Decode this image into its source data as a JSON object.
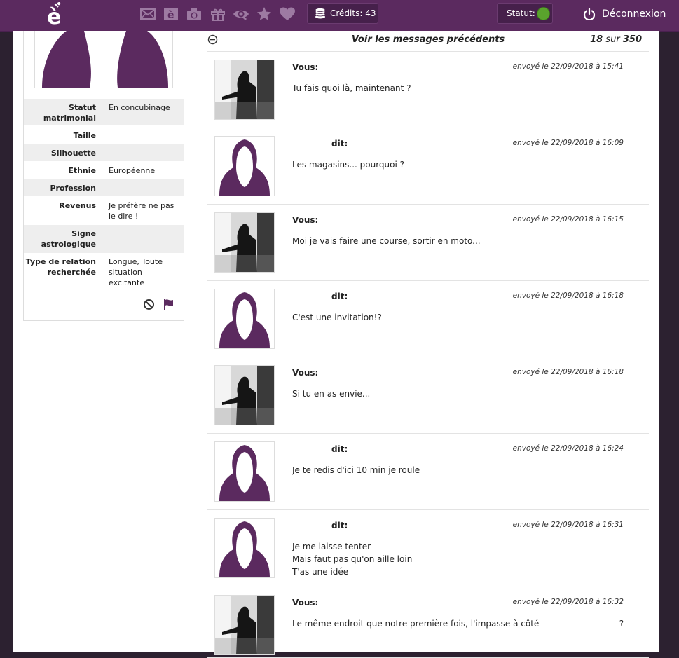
{
  "topbar": {
    "logo": "è",
    "nav_icons": [
      {
        "name": "mail-icon"
      },
      {
        "name": "e-icon",
        "glyph": "è"
      },
      {
        "name": "camera-icon"
      },
      {
        "name": "gift-icon"
      },
      {
        "name": "eye-icon"
      },
      {
        "name": "star-icon"
      },
      {
        "name": "heart-icon"
      }
    ],
    "credits_label": "Crédits: 43",
    "status_label": "Statut:",
    "status_color": "#5aa32d",
    "logout_label": "Déconnexion"
  },
  "colors": {
    "brand": "#5b2a5f",
    "avatar_purple": "#5b2a5f"
  },
  "profile": {
    "attributes": [
      {
        "key": "Statut matrimonial",
        "value": "En concubinage"
      },
      {
        "key": "Taille",
        "value": ""
      },
      {
        "key": "Silhouette",
        "value": ""
      },
      {
        "key": "Ethnie",
        "value": "Européenne"
      },
      {
        "key": "Profession",
        "value": ""
      },
      {
        "key": "Revenus",
        "value": "Je préfère ne pas le dire !"
      },
      {
        "key": "Signe astrologique",
        "value": ""
      },
      {
        "key": "Type de relation recherchée",
        "value": "Longue, Toute situation excitante"
      }
    ]
  },
  "conversation": {
    "prev_label": "Voir les messages précédents",
    "count_shown": "18",
    "count_sep": "sur",
    "count_total": "350",
    "messages": [
      {
        "from": "me",
        "sender": "Vous:",
        "date": "envoyé le 22/09/2018 à 15:41",
        "lines": [
          "Tu fais quoi là, maintenant ?"
        ]
      },
      {
        "from": "her",
        "sender": "dit:",
        "date": "envoyé le 22/09/2018 à 16:09",
        "lines": [
          "Les magasins... pourquoi ?"
        ]
      },
      {
        "from": "me",
        "sender": "Vous:",
        "date": "envoyé le 22/09/2018 à 16:15",
        "lines": [
          "Moi je vais faire une course, sortir en moto..."
        ]
      },
      {
        "from": "her",
        "sender": "dit:",
        "date": "envoyé le 22/09/2018 à 16:18",
        "lines": [
          "C'est une invitation!?"
        ]
      },
      {
        "from": "me",
        "sender": "Vous:",
        "date": "envoyé le 22/09/2018 à 16:18",
        "lines": [
          "Si tu en as envie..."
        ]
      },
      {
        "from": "her",
        "sender": "dit:",
        "date": "envoyé le 22/09/2018 à 16:24",
        "lines": [
          "Je te redis d'ici 10 min je roule"
        ]
      },
      {
        "from": "her",
        "sender": "dit:",
        "date": "envoyé le 22/09/2018 à 16:31",
        "lines": [
          "Je me laisse tenter",
          "Mais faut pas qu'on aille loin",
          "T'as une idée"
        ]
      },
      {
        "from": "me",
        "sender": "Vous:",
        "date": "envoyé le 22/09/2018 à 16:32",
        "lines": [
          "Le même endroit que notre première fois, l'impasse à côté                              ?"
        ]
      }
    ]
  }
}
